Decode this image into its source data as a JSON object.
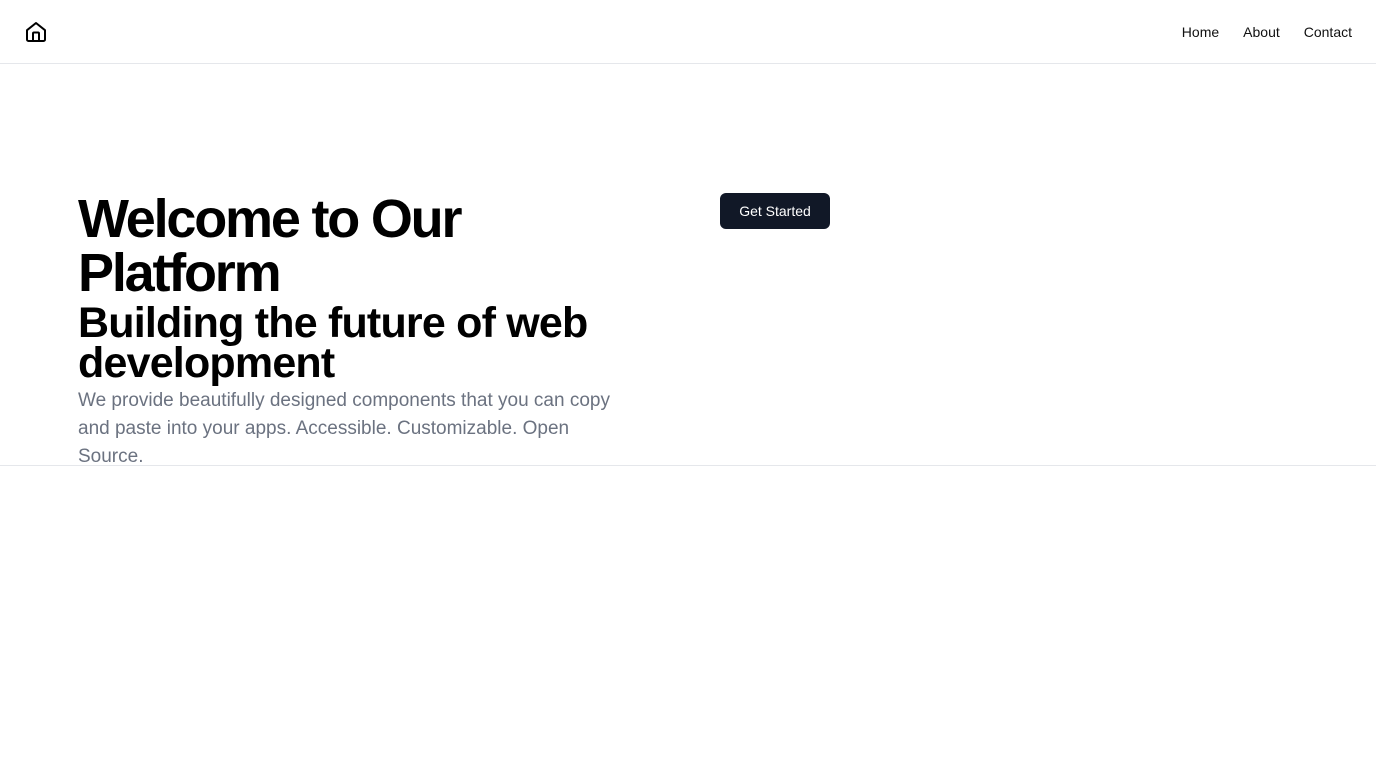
{
  "header": {
    "logo_icon": "home-icon",
    "nav": {
      "home_label": "Home",
      "about_label": "About",
      "contact_label": "Contact"
    }
  },
  "hero": {
    "title": "Welcome to Our Platform",
    "subtitle": "Building the future of web development",
    "description": "We provide beautifully designed components that you can copy and paste into your apps. Accessible. Customizable. Open Source.",
    "cta_label": "Get Started"
  },
  "colors": {
    "primary_button": "#111827",
    "muted_text": "#6b7280",
    "border": "#e5e7eb"
  }
}
